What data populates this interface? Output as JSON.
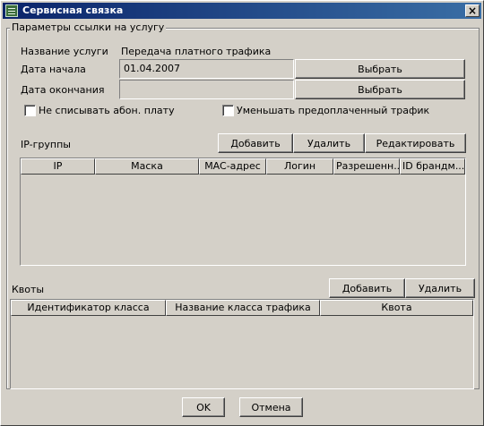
{
  "window": {
    "title": "Сервисная связка",
    "close_glyph": "×"
  },
  "group": {
    "legend": "Параметры ссылки на услугу"
  },
  "service": {
    "label": "Название услуги",
    "value": "Передача платного трафика"
  },
  "start_date": {
    "label": "Дата начала",
    "value": "01.04.2007",
    "button": "Выбрать"
  },
  "end_date": {
    "label": "Дата окончания",
    "value": "",
    "button": "Выбрать"
  },
  "checkboxes": {
    "no_fee": {
      "label": "Не списывать абон. плату",
      "checked": false
    },
    "reduce_prepaid": {
      "label": "Уменьшать предоплаченный трафик",
      "checked": false
    }
  },
  "ip_groups": {
    "label": "IP-группы",
    "add": "Добавить",
    "remove": "Удалить",
    "edit": "Редактировать",
    "columns": [
      "IP",
      "Маска",
      "MAC-адрес",
      "Логин",
      "Разрешенн...",
      "ID брандм..."
    ]
  },
  "quotas": {
    "label": "Квоты",
    "add": "Добавить",
    "remove": "Удалить",
    "columns": [
      "Идентификатор класса",
      "Название класса трафика",
      "Квота"
    ]
  },
  "footer": {
    "ok": "OK",
    "cancel": "Отмена"
  }
}
